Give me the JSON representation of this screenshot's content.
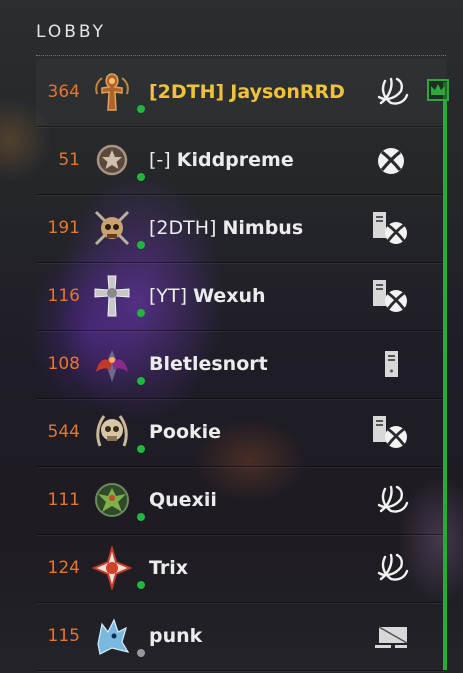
{
  "lobby": {
    "title": "LOBBY"
  },
  "colors": {
    "accent": "#2fa83a",
    "host": "#f0c13a",
    "level": "#e6762d",
    "online": "#1fb83a",
    "offline": "#9a9a9a"
  },
  "players": [
    {
      "level": "364",
      "tag": "[2DTH]",
      "name": "JaysonRRD",
      "host": true,
      "status": "online",
      "emblem": "ornate-ankh-emblem",
      "platform": "battlenet"
    },
    {
      "level": "51",
      "tag": "[-]",
      "name": "Kiddpreme",
      "host": false,
      "status": "online",
      "emblem": "star-medal-emblem",
      "platform": "xbox"
    },
    {
      "level": "191",
      "tag": "[2DTH]",
      "name": "Nimbus",
      "host": false,
      "status": "online",
      "emblem": "skull-swords-emblem",
      "platform": "server-xbox"
    },
    {
      "level": "116",
      "tag": "[YT]",
      "name": "Wexuh",
      "host": false,
      "status": "online",
      "emblem": "silver-cross-emblem",
      "platform": "server-xbox"
    },
    {
      "level": "108",
      "tag": "",
      "name": "Bletlesnort",
      "host": false,
      "status": "online",
      "emblem": "red-wings-emblem",
      "platform": "server"
    },
    {
      "level": "544",
      "tag": "",
      "name": "Pookie",
      "host": false,
      "status": "online",
      "emblem": "laurel-skull-emblem",
      "platform": "server-xbox"
    },
    {
      "level": "111",
      "tag": "",
      "name": "Quexii",
      "host": false,
      "status": "online",
      "emblem": "green-eagle-emblem",
      "platform": "battlenet"
    },
    {
      "level": "124",
      "tag": "",
      "name": "Trix",
      "host": false,
      "status": "online",
      "emblem": "red-star-emblem",
      "platform": "battlenet"
    },
    {
      "level": "115",
      "tag": "",
      "name": "punk",
      "host": false,
      "status": "offline",
      "emblem": "blue-wolf-emblem",
      "platform": "desktop"
    }
  ]
}
